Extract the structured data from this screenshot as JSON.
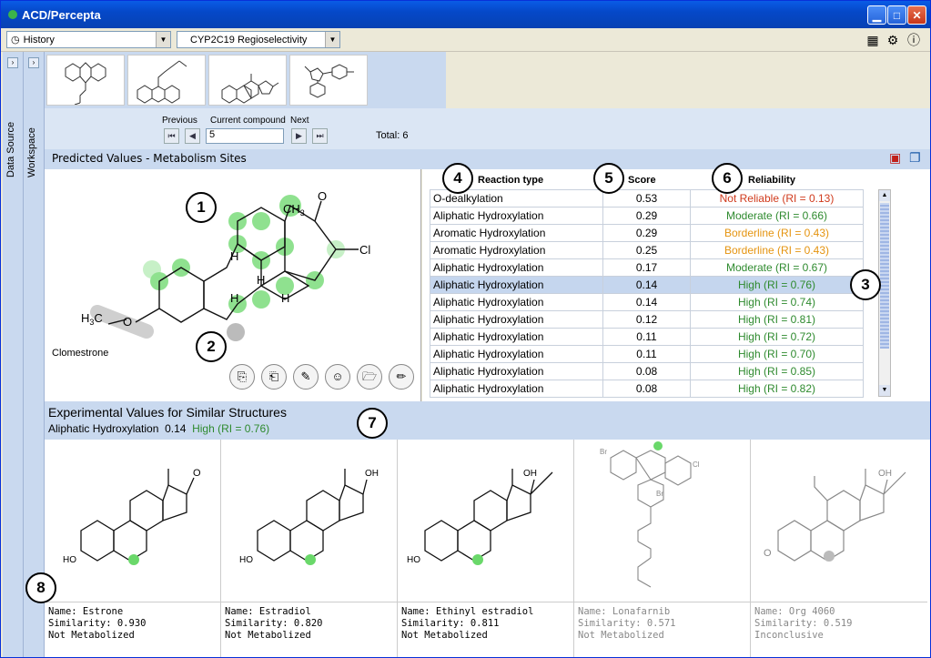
{
  "window": {
    "title": "ACD/Percepta"
  },
  "toolbar": {
    "history_label": "History",
    "module_value": "CYP2C19 Regioselectivity"
  },
  "sidebar": {
    "data_source": "Data Source",
    "workspace": "Workspace"
  },
  "nav": {
    "previous_label": "Previous",
    "current_label": "Current compound",
    "next_label": "Next",
    "current_value": "5",
    "total": "Total: 6"
  },
  "predicted": {
    "title": "Predicted Values - Metabolism Sites",
    "compound_name": "Clomestrone"
  },
  "table": {
    "headers": {
      "reaction": "Reaction type",
      "score": "Score",
      "reliability": "Reliability"
    },
    "rows": [
      {
        "reaction": "O-dealkylation",
        "score": "0.53",
        "reliability": "Not Reliable (RI = 0.13)",
        "level": "red"
      },
      {
        "reaction": "Aliphatic Hydroxylation",
        "score": "0.29",
        "reliability": "Moderate (RI = 0.66)",
        "level": "green"
      },
      {
        "reaction": "Aromatic Hydroxylation",
        "score": "0.29",
        "reliability": "Borderline (RI = 0.43)",
        "level": "orange"
      },
      {
        "reaction": "Aromatic Hydroxylation",
        "score": "0.25",
        "reliability": "Borderline (RI = 0.43)",
        "level": "orange"
      },
      {
        "reaction": "Aliphatic Hydroxylation",
        "score": "0.17",
        "reliability": "Moderate (RI = 0.67)",
        "level": "green"
      },
      {
        "reaction": "Aliphatic Hydroxylation",
        "score": "0.14",
        "reliability": "High (RI = 0.76)",
        "level": "green",
        "selected": true
      },
      {
        "reaction": "Aliphatic Hydroxylation",
        "score": "0.14",
        "reliability": "High (RI = 0.74)",
        "level": "green"
      },
      {
        "reaction": "Aliphatic Hydroxylation",
        "score": "0.12",
        "reliability": "High (RI = 0.81)",
        "level": "green"
      },
      {
        "reaction": "Aliphatic Hydroxylation",
        "score": "0.11",
        "reliability": "High (RI = 0.72)",
        "level": "green"
      },
      {
        "reaction": "Aliphatic Hydroxylation",
        "score": "0.11",
        "reliability": "High (RI = 0.70)",
        "level": "green"
      },
      {
        "reaction": "Aliphatic Hydroxylation",
        "score": "0.08",
        "reliability": "High (RI = 0.85)",
        "level": "green"
      },
      {
        "reaction": "Aliphatic Hydroxylation",
        "score": "0.08",
        "reliability": "High (RI = 0.82)",
        "level": "green"
      }
    ]
  },
  "experimental": {
    "title": "Experimental Values for Similar Structures",
    "sel_reaction": "Aliphatic Hydroxylation",
    "sel_score": "0.14",
    "sel_reliability": "High (RI = 0.76)"
  },
  "cards": [
    {
      "name": "Name: Estrone",
      "similarity": "Similarity: 0.930",
      "status": "Not Metabolized"
    },
    {
      "name": "Name: Estradiol",
      "similarity": "Similarity: 0.820",
      "status": "Not Metabolized"
    },
    {
      "name": "Name: Ethinyl estradiol",
      "similarity": "Similarity: 0.811",
      "status": "Not Metabolized"
    },
    {
      "name": "Name: Lonafarnib",
      "similarity": "Similarity: 0.571",
      "status": "Not Metabolized"
    },
    {
      "name": "Name: Org 4060",
      "similarity": "Similarity: 0.519",
      "status": "Inconclusive"
    }
  ],
  "callouts": [
    "1",
    "2",
    "3",
    "4",
    "5",
    "6",
    "7",
    "8"
  ],
  "colors": {
    "red": "#d03a1c",
    "green": "#2e8a2e",
    "orange": "#e59410",
    "accent": "#c9d9ef"
  }
}
